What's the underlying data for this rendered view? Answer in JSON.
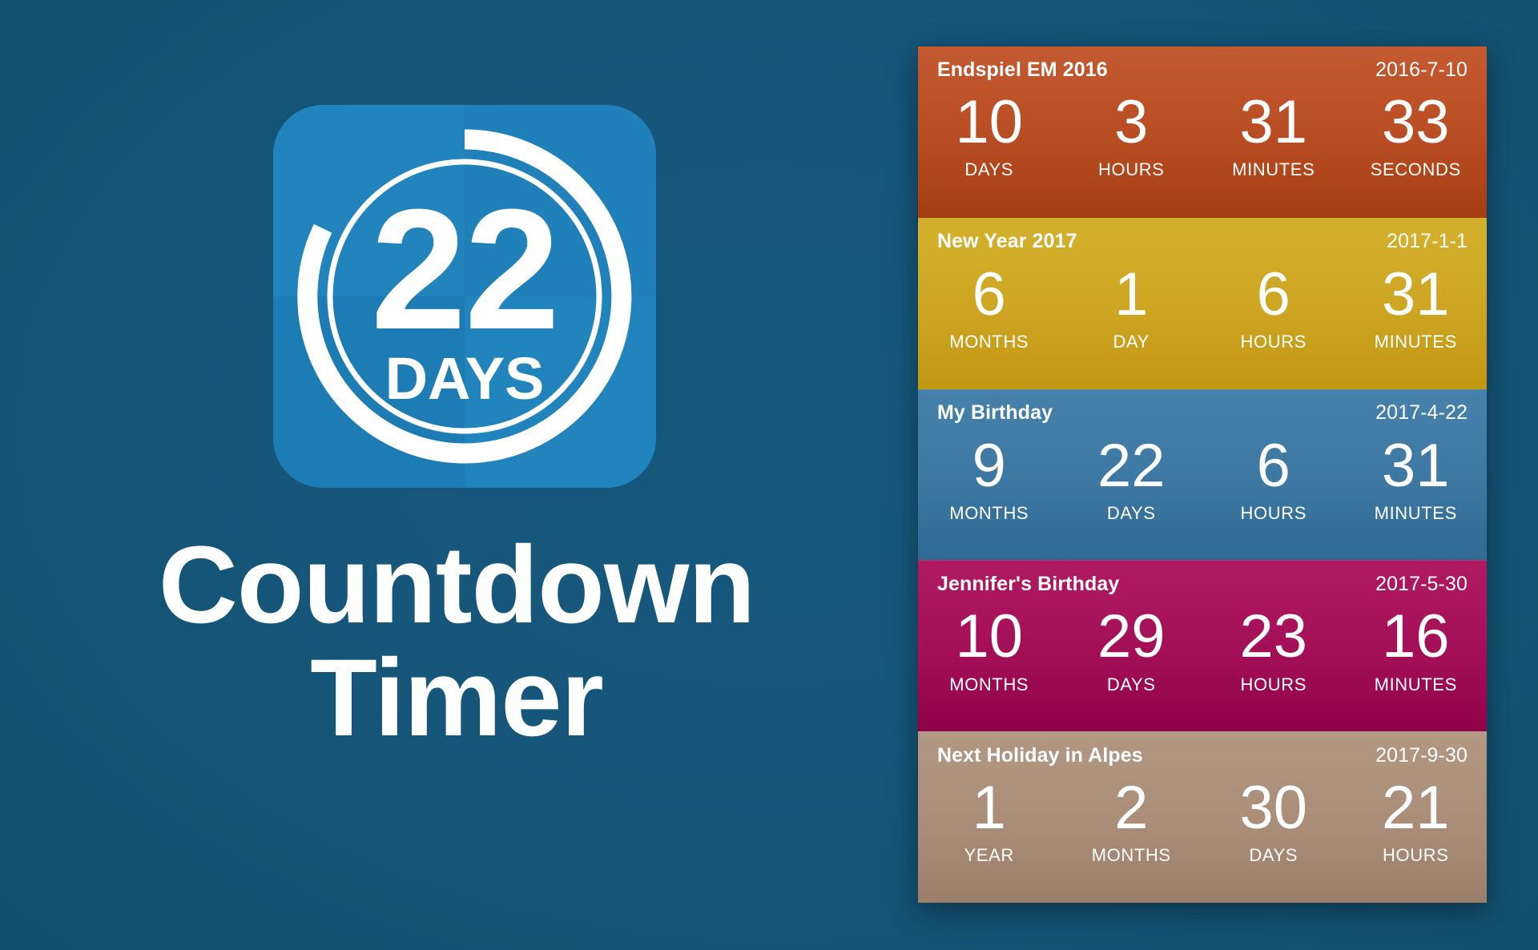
{
  "theme": {
    "background_color": "#15567a",
    "icon_blue": "#2184bd",
    "text_color": "#ffffff"
  },
  "promo": {
    "icon": {
      "name": "countdown-ring-icon",
      "number": "22",
      "unit": "DAYS",
      "progress_percent": 72
    },
    "title_line_1": "Countdown",
    "title_line_2": "Timer"
  },
  "list_panel": {
    "rows": [
      {
        "event_name": "Endspiel EM 2016",
        "event_date": "2016-7-10",
        "color": "#b84c22",
        "units": [
          {
            "value": "10",
            "label": "DAYS"
          },
          {
            "value": "3",
            "label": "HOURS"
          },
          {
            "value": "31",
            "label": "MINUTES"
          },
          {
            "value": "33",
            "label": "SECONDS"
          }
        ]
      },
      {
        "event_name": "New Year 2017",
        "event_date": "2017-1-1",
        "color": "#cda522",
        "units": [
          {
            "value": "6",
            "label": "MONTHS"
          },
          {
            "value": "1",
            "label": "DAY"
          },
          {
            "value": "6",
            "label": "HOURS"
          },
          {
            "value": "31",
            "label": "MINUTES"
          }
        ]
      },
      {
        "event_name": "My Birthday",
        "event_date": "2017-4-22",
        "color": "#3d78a2",
        "units": [
          {
            "value": "9",
            "label": "MONTHS"
          },
          {
            "value": "22",
            "label": "DAYS"
          },
          {
            "value": "6",
            "label": "HOURS"
          },
          {
            "value": "31",
            "label": "MINUTES"
          }
        ]
      },
      {
        "event_name": "Jennifer's Birthday",
        "event_date": "2017-5-30",
        "color": "#a30f56",
        "units": [
          {
            "value": "10",
            "label": "MONTHS"
          },
          {
            "value": "29",
            "label": "DAYS"
          },
          {
            "value": "23",
            "label": "HOURS"
          },
          {
            "value": "16",
            "label": "MINUTES"
          }
        ]
      },
      {
        "event_name": "Next Holiday in Alpes",
        "event_date": "2017-9-30",
        "color": "#a98d79",
        "units": [
          {
            "value": "1",
            "label": "YEAR"
          },
          {
            "value": "2",
            "label": "MONTHS"
          },
          {
            "value": "30",
            "label": "DAYS"
          },
          {
            "value": "21",
            "label": "HOURS"
          }
        ]
      }
    ]
  }
}
